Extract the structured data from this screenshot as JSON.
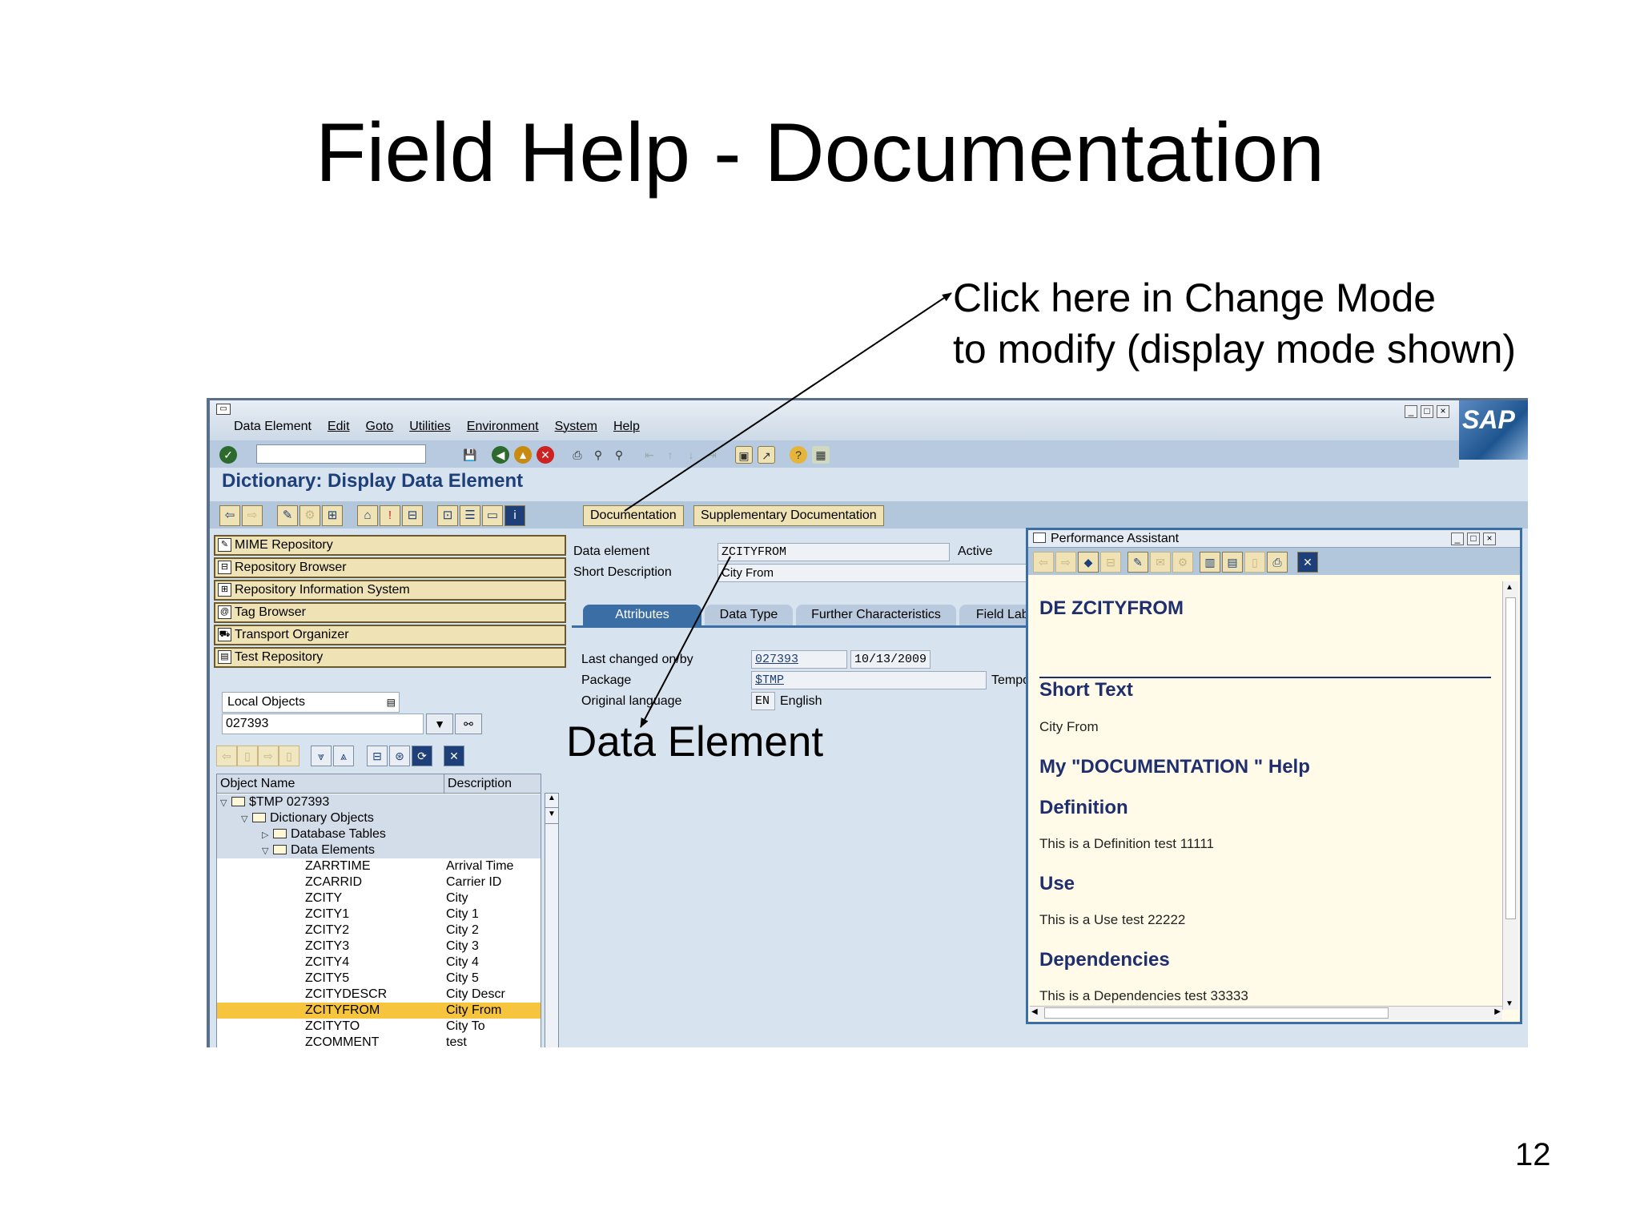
{
  "slide": {
    "title": "Field Help - Documentation",
    "callout_line1": "Click here in Change Mode",
    "callout_line2": "to modify (display mode shown)",
    "data_element_label": "Data Element",
    "page_number": "12"
  },
  "sap": {
    "menu": [
      "Data Element",
      "Edit",
      "Goto",
      "Utilities",
      "Environment",
      "System",
      "Help"
    ],
    "logo": "SAP",
    "screen_title": "Dictionary: Display Data Element",
    "buttons": {
      "documentation": "Documentation",
      "supplementary": "Supplementary Documentation"
    },
    "nav_buttons": [
      "MIME Repository",
      "Repository Browser",
      "Repository Information System",
      "Tag Browser",
      "Transport Organizer",
      "Test Repository"
    ],
    "object_list": {
      "selected": "Local Objects",
      "user": "027393"
    },
    "tree": {
      "headers": {
        "name": "Object Name",
        "description": "Description"
      },
      "nodes": [
        {
          "name": "$TMP 027393",
          "description": ""
        },
        {
          "name": "Dictionary Objects",
          "description": ""
        },
        {
          "name": "Database Tables",
          "description": ""
        },
        {
          "name": "Data Elements",
          "description": ""
        }
      ],
      "items": [
        {
          "name": "ZARRTIME",
          "description": "Arrival Time"
        },
        {
          "name": "ZCARRID",
          "description": "Carrier ID"
        },
        {
          "name": "ZCITY",
          "description": "City"
        },
        {
          "name": "ZCITY1",
          "description": "City 1"
        },
        {
          "name": "ZCITY2",
          "description": "City 2"
        },
        {
          "name": "ZCITY3",
          "description": "City 3"
        },
        {
          "name": "ZCITY4",
          "description": "City 4"
        },
        {
          "name": "ZCITY5",
          "description": "City 5"
        },
        {
          "name": "ZCITYDESCR",
          "description": "City Descr"
        },
        {
          "name": "ZCITYFROM",
          "description": "City From"
        },
        {
          "name": "ZCITYTO",
          "description": "City To"
        },
        {
          "name": "ZCOMMENT",
          "description": "test"
        }
      ]
    },
    "form": {
      "data_element_label": "Data element",
      "data_element_value": "ZCITYFROM",
      "status": "Active",
      "short_desc_label": "Short Description",
      "short_desc_value": "City From",
      "tabs": [
        "Attributes",
        "Data Type",
        "Further Characteristics",
        "Field Label"
      ],
      "last_changed_label": "Last changed on/by",
      "last_changed_user": "027393",
      "last_changed_date": "10/13/2009",
      "package_label": "Package",
      "package_value": "$TMP",
      "package_desc": "Tempo",
      "orig_lang_label": "Original language",
      "orig_lang_code": "EN",
      "orig_lang_name": "English"
    },
    "performance_assistant": {
      "title": "Performance Assistant",
      "heading": "DE ZCITYFROM",
      "short_text_heading": "Short Text",
      "short_text": "City From",
      "doc_heading": "My \"DOCUMENTATION \" Help",
      "definition_heading": "Definition",
      "definition_text": "This is a Definition test 11111",
      "use_heading": "Use",
      "use_text": "This is a Use test  22222",
      "dependencies_heading": "Dependencies",
      "dependencies_text": "This is a Dependencies test  33333"
    }
  }
}
